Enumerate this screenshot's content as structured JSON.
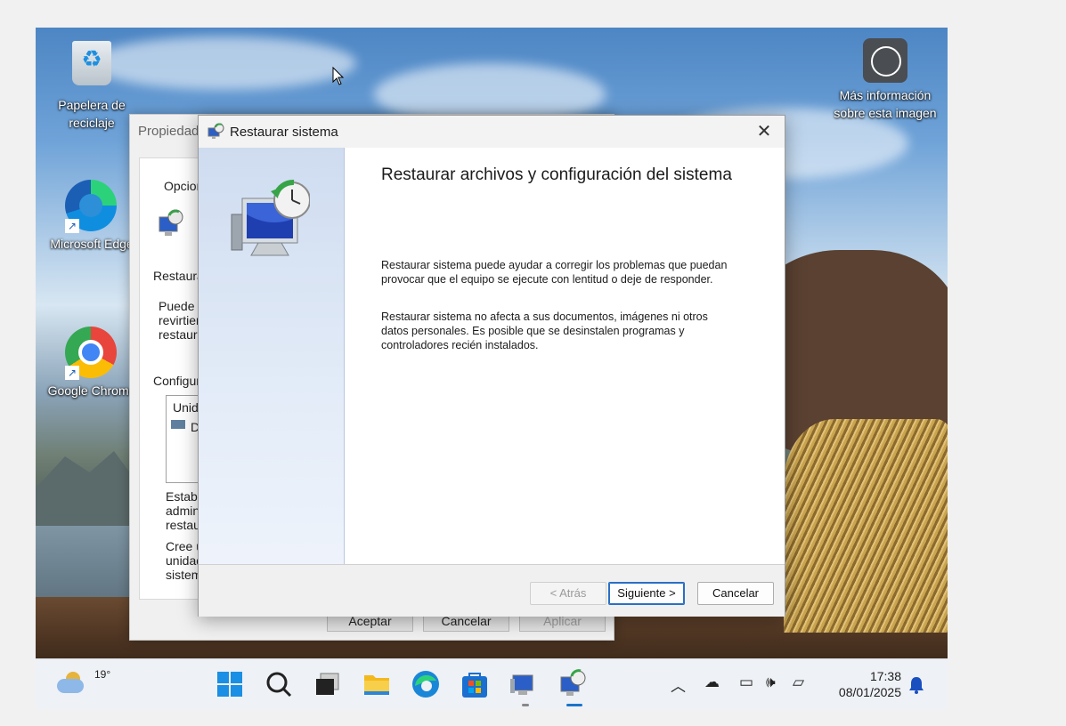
{
  "desktop": {
    "icons": [
      {
        "label": "Papelera de reciclaje"
      },
      {
        "label": "Microsoft Edge"
      },
      {
        "label": "Google Chrome"
      },
      {
        "label": "Más información sobre esta imagen"
      }
    ]
  },
  "back_window": {
    "title": "Propiedad",
    "tab": "Opcion",
    "text_restaurar": "Restaura",
    "text_puede": "Puede",
    "text_revirtien": "revirtien",
    "text_restaura2": "restaura",
    "text_configura": "Configura",
    "list_header": "Unid",
    "list_item": "D",
    "text_establ": "Establ",
    "text_admin": "admin",
    "text_restau": "restau",
    "text_cree": "Cree u",
    "text_unidad": "unidad",
    "text_sistem": "sistem",
    "buttons": {
      "accept": "Aceptar",
      "cancel": "Cancelar",
      "apply": "Aplicar"
    }
  },
  "dialog": {
    "title": "Restaurar sistema",
    "heading": "Restaurar archivos y configuración del sistema",
    "para1_l1": "Restaurar sistema puede ayudar a corregir los problemas que puedan",
    "para1_l2": "provocar que el equipo se ejecute con lentitud o deje de responder.",
    "para2_l1": "Restaurar sistema no afecta a sus documentos, imágenes ni otros",
    "para2_l2": "datos personales. Es posible que se desinstalen programas y",
    "para2_l3": "controladores recién instalados.",
    "buttons": {
      "back": "< Atrás",
      "next": "Siguiente >",
      "cancel": "Cancelar"
    }
  },
  "taskbar": {
    "weather_temp": "19°",
    "time": "17:38",
    "date": "08/01/2025"
  },
  "colors": {
    "accent": "#1a73c9",
    "dialog_side": "#dce6f5"
  }
}
